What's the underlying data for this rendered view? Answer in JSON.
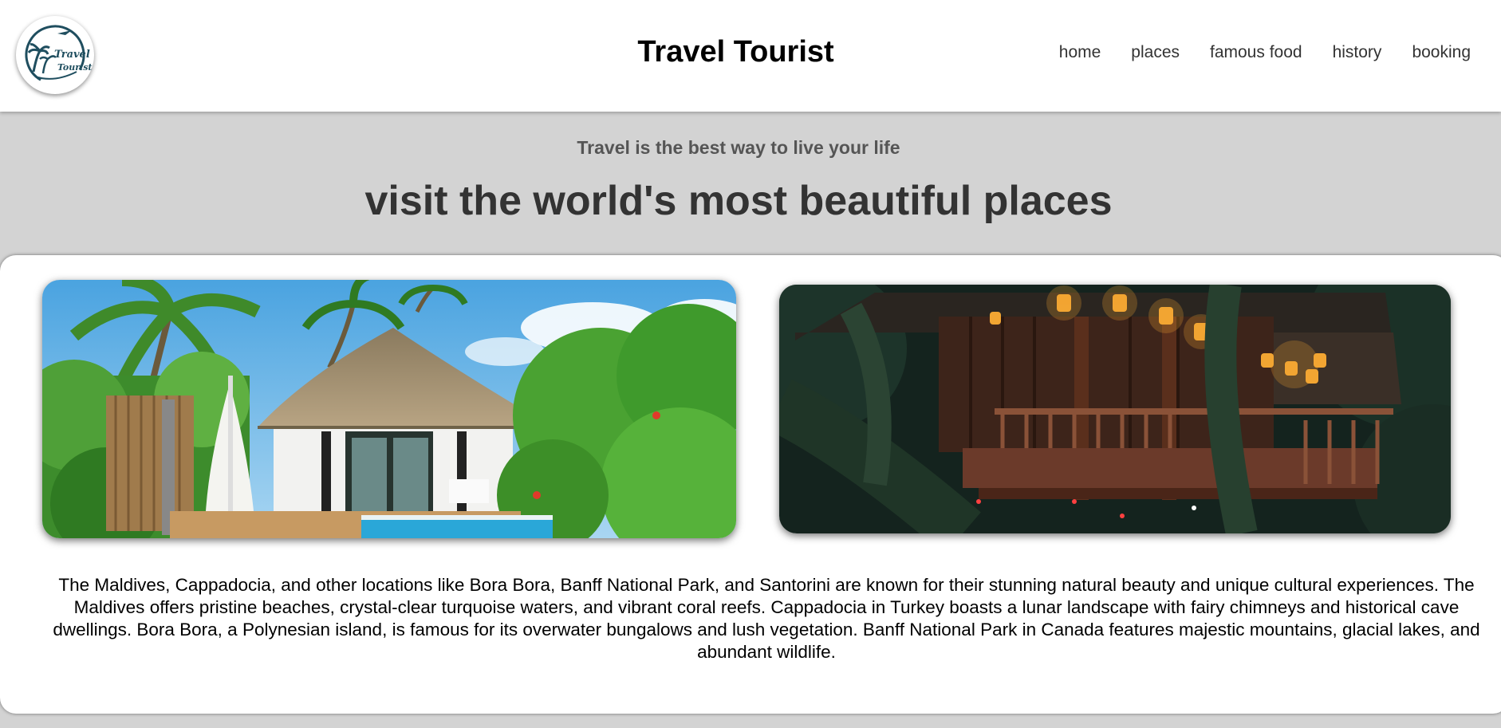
{
  "header": {
    "logo_alt": "Travel Tourist",
    "title": "Travel Tourist",
    "nav": [
      "home",
      "places",
      "famous food",
      "history",
      "booking"
    ]
  },
  "hero": {
    "tagline": "Travel is the best way to live your life",
    "headline": "visit the world's most beautiful places"
  },
  "gallery": {
    "images": [
      {
        "description": "thatched-roof beach villa with a plunge pool among palm trees"
      },
      {
        "description": "wooden treehouse lodge with glowing lanterns in a dark jungle"
      }
    ]
  },
  "content": {
    "paragraph": "The Maldives, Cappadocia, and other locations like Bora Bora, Banff National Park, and Santorini are known for their stunning natural beauty and unique cultural experiences. The Maldives offers pristine beaches, crystal-clear turquoise waters, and vibrant coral reefs. Cappadocia in Turkey boasts a lunar landscape with fairy chimneys and historical cave dwellings. Bora Bora, a Polynesian island, is famous for its overwater bungalows and lush vegetation. Banff National Park in Canada features majestic mountains, glacial lakes, and abundant wildlife."
  },
  "colors": {
    "page_background": "#d3d3d3",
    "header_background": "#ffffff",
    "card_background": "#ffffff",
    "logo_teal": "#1f4e5f"
  }
}
